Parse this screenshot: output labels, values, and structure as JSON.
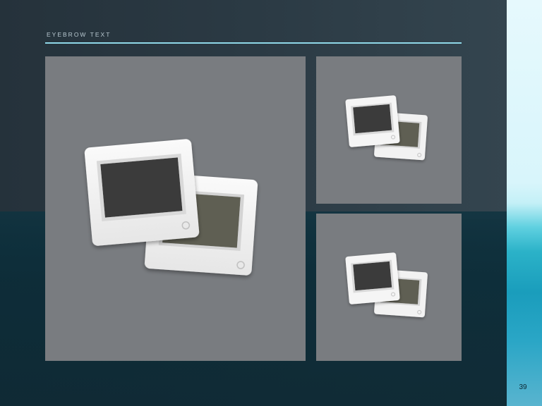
{
  "slide": {
    "eyebrow": "EYEBROW TEXT",
    "page_number": "39"
  },
  "placeholders": [
    {
      "name": "image-placeholder-large",
      "icon": "photo-slides-icon"
    },
    {
      "name": "image-placeholder-small-top",
      "icon": "photo-slides-icon"
    },
    {
      "name": "image-placeholder-small-bottom",
      "icon": "photo-slides-icon"
    }
  ],
  "colors": {
    "rule": "#8fd8e8",
    "tile": "#797c80",
    "slide_frame": "#f2f2f2",
    "photo_dark": "#3a3a3a",
    "photo_olive": "#5e5e52"
  }
}
